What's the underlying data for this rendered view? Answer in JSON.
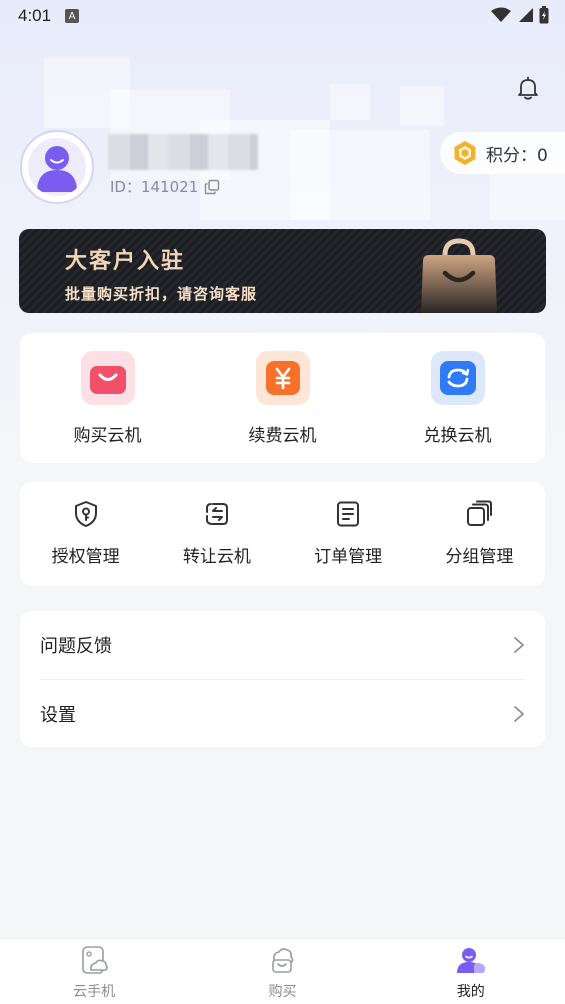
{
  "status_bar": {
    "time": "4:01",
    "a_badge": "A"
  },
  "profile": {
    "id_label": "ID：141021"
  },
  "points": {
    "label": "积分：0"
  },
  "banner": {
    "title": "大客户入驻",
    "subtitle": "批量购买折扣，请咨询客服"
  },
  "buy_section": {
    "items": [
      {
        "label": "购买云机",
        "icon": "shopping-bag-icon",
        "color": "#f2506a"
      },
      {
        "label": "续费云机",
        "icon": "yuan-icon",
        "color": "#f6722a"
      },
      {
        "label": "兑换云机",
        "icon": "exchange-icon",
        "color": "#2f7af5"
      }
    ]
  },
  "manage_section": {
    "items": [
      {
        "label": "授权管理",
        "icon": "shield-key-icon"
      },
      {
        "label": "转让云机",
        "icon": "transfer-icon"
      },
      {
        "label": "订单管理",
        "icon": "order-icon"
      },
      {
        "label": "分组管理",
        "icon": "group-icon"
      }
    ]
  },
  "menu": {
    "items": [
      {
        "label": "问题反馈"
      },
      {
        "label": "设置"
      }
    ]
  },
  "tabbar": {
    "items": [
      {
        "label": "云手机",
        "active": false
      },
      {
        "label": "购买",
        "active": false
      },
      {
        "label": "我的",
        "active": true
      }
    ]
  }
}
